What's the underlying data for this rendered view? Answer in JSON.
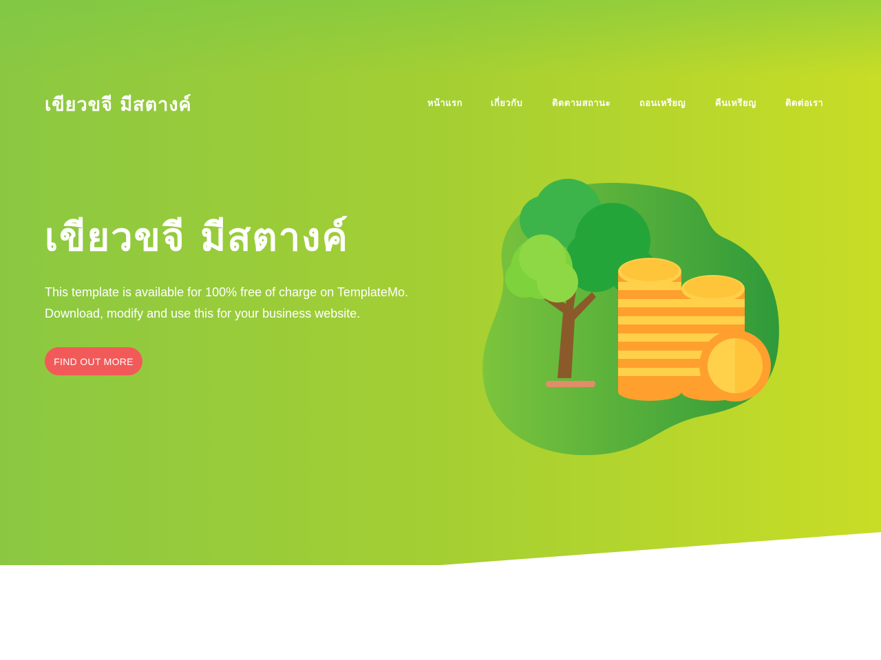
{
  "header": {
    "logo": "เขียวขจี มีสตางค์",
    "nav": [
      "หน้าแรก",
      "เกี่ยวกับ",
      "ติดตามสถานะ",
      "ถอนเหรียญ",
      "คืนเหรียญ",
      "ติดต่อเรา"
    ]
  },
  "hero": {
    "headline": "เขียวขจี มีสตางค์",
    "description_line1": "This template is available for 100% free of charge on TemplateMo.",
    "description_line2": "Download, modify and use this for your business website.",
    "cta_label": "FIND OUT MORE"
  },
  "illustration": {
    "name": "money-tree-coins-illustration"
  },
  "colors": {
    "hero_gradient_start": "#8bc842",
    "hero_gradient_end": "#c8dd26",
    "cta_bg": "#f25a5a",
    "coin_gold": "#ffd04a",
    "coin_orange": "#ff9f2e",
    "blob_green": "#3aa63a"
  }
}
